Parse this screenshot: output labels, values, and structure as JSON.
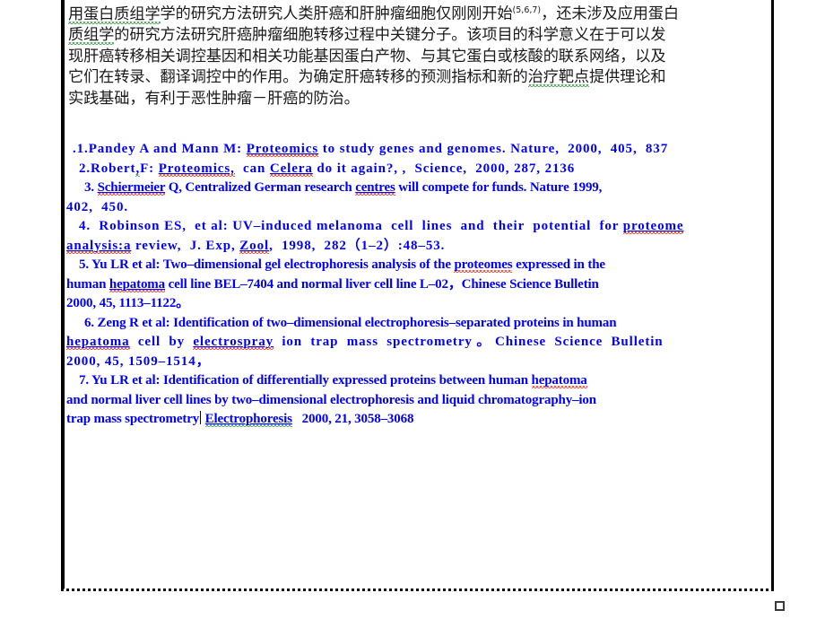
{
  "document": {
    "type": "slide-editor-text-frame",
    "background_color": "#ffffff",
    "frame_border_color": "#000000",
    "body_text_color": "#1a1a1a",
    "reference_text_color": "#0000ff",
    "spelling_underline_color": "#e02a18",
    "grammar_underline_color": "#2f8f3f"
  },
  "body": {
    "paragraph_lines": [
      "用蛋白质组学的研究方法研究人类肝癌和肝肿瘤细胞仅刚刚开始",
      "质组学的研究方法研究肝癌肿瘤细胞转移过程中关键分子。该项目的科学意义在于可以发",
      "现肝癌转移相关调控基因和相关功能基因蛋白产物、与其它蛋白或核酸的联系网络，以及",
      "它们在转录、翻译调控中的作用。为确定肝癌转移的预测指标和新的治疗靶点提供理论和",
      "实践基础，有利于恶性肿瘤－肝癌的防治。"
    ],
    "line1_prefix": "用蛋白质组学的研究方法研究人类肝癌和肝肿瘤细胞仅刚刚开始",
    "line1_superscript": "(5,6,7)",
    "line1_suffix": "，还未涉及应用蛋白",
    "line1_grammar_span": "用蛋白质组学",
    "line2_grammar_span": "质组学",
    "line4_grammar_span": "治疗靶点"
  },
  "references": {
    "items": [
      {
        "number": ".1.",
        "lines": [
          {
            "segments": [
              {
                "text": ".1.Pandey A and Mann M: ",
                "style": "plain"
              },
              {
                "text": "Proteomics",
                "style": "spell-underline"
              },
              {
                "text": " to study genes and genomes. Nature,  2000,  405,  837",
                "style": "plain"
              }
            ]
          }
        ]
      },
      {
        "number": "2.",
        "lines": [
          {
            "segments": [
              {
                "text": "2.Robert",
                "style": "plain"
              },
              {
                "text": ",",
                "style": "grammar"
              },
              {
                "text": "F: ",
                "style": "plain"
              },
              {
                "text": "Proteomics,",
                "style": "spell-underline"
              },
              {
                "text": "  can ",
                "style": "plain"
              },
              {
                "text": "Celera",
                "style": "spell-underline"
              },
              {
                "text": " do it again?, ,  Science,  2000, 287, 2136",
                "style": "plain"
              }
            ]
          }
        ]
      },
      {
        "number": "3.",
        "lines": [
          {
            "segments": [
              {
                "text": "3. ",
                "style": "plain"
              },
              {
                "text": "Schiermeier",
                "style": "spell-underline"
              },
              {
                "text": " Q, Centralized German research ",
                "style": "plain"
              },
              {
                "text": "centres",
                "style": "spell-underline"
              },
              {
                "text": " will compete for funds. Nature 1999,",
                "style": "plain"
              }
            ]
          },
          {
            "segments": [
              {
                "text": "402,  450.",
                "style": "plain"
              }
            ]
          }
        ]
      },
      {
        "number": "4.",
        "lines": [
          {
            "segments": [
              {
                "text": "4.  Robinson ES,  et al: UV–induced melanoma  cell  lines  and  their  potential  for ",
                "style": "plain"
              },
              {
                "text": "proteome",
                "style": "spell-underline"
              }
            ]
          },
          {
            "segments": [
              {
                "text": "analysis:a",
                "style": "spell-underline"
              },
              {
                "text": " review,  J. Exp, ",
                "style": "plain"
              },
              {
                "text": "Zool",
                "style": "spell-underline"
              },
              {
                "text": ",  1998,  282（1–2）:48–53.",
                "style": "plain"
              }
            ]
          }
        ]
      },
      {
        "number": "5.",
        "lines": [
          {
            "segments": [
              {
                "text": "5. Yu LR et al: Two–dimensional gel electrophoresis analysis of the ",
                "style": "plain"
              },
              {
                "text": "proteomes",
                "style": "spell-underline"
              },
              {
                "text": " expressed in the",
                "style": "plain"
              }
            ]
          },
          {
            "segments": [
              {
                "text": "human ",
                "style": "plain"
              },
              {
                "text": "hepatoma",
                "style": "spell-underline"
              },
              {
                "text": " cell line BEL–7404 and normal liver cell line L–02，Chinese Science Bulletin",
                "style": "plain"
              }
            ]
          },
          {
            "segments": [
              {
                "text": "2000, 45, 1113–1122。",
                "style": "plain"
              }
            ]
          }
        ]
      },
      {
        "number": "6.",
        "lines": [
          {
            "segments": [
              {
                "text": "6. Zeng R et al: Identification of two–dimensional electrophoresis–separated proteins in human",
                "style": "plain"
              }
            ]
          },
          {
            "segments": [
              {
                "text": "hepatoma",
                "style": "spell-underline"
              },
              {
                "text": "  cell  by  ",
                "style": "plain"
              },
              {
                "text": "electrospray",
                "style": "spell-underline"
              },
              {
                "text": "  ion  trap  mass  spectrometry 。 Chinese  Science  Bulletin",
                "style": "plain"
              }
            ]
          },
          {
            "segments": [
              {
                "text": "2000, 45, 1509–1514，",
                "style": "plain"
              }
            ]
          }
        ]
      },
      {
        "number": "7.",
        "lines": [
          {
            "segments": [
              {
                "text": "7. Yu LR et al: Identification of differentially expressed proteins between human ",
                "style": "plain"
              },
              {
                "text": "hepatoma",
                "style": "spell-underline"
              }
            ]
          },
          {
            "segments": [
              {
                "text": "and normal liver cell lines by two–dimensional electrophoresis and liquid chromatography–ion",
                "style": "plain"
              }
            ]
          },
          {
            "segments": [
              {
                "text": "trap mass spectrometry",
                "style": "plain"
              },
              {
                "text": "caret",
                "style": "caret"
              },
              {
                "text": " ",
                "style": "plain"
              },
              {
                "text": "Electrophoresis",
                "style": "grammar"
              },
              {
                "text": "   2000, 21, 3058–3068",
                "style": "plain"
              }
            ]
          }
        ]
      }
    ]
  },
  "ui": {
    "resize_handle_label": "resize-handle"
  }
}
